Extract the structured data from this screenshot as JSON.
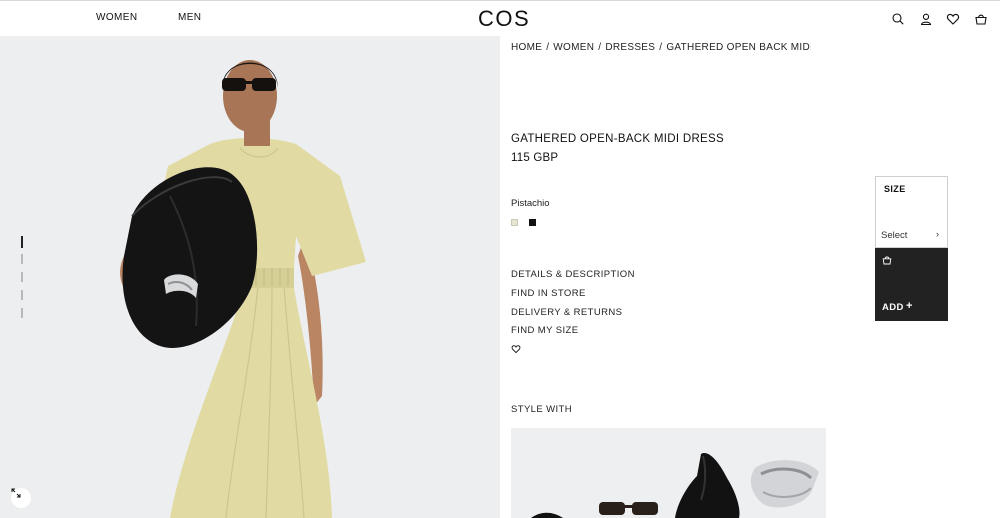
{
  "header": {
    "nav": [
      "WOMEN",
      "MEN"
    ],
    "logo": "COS",
    "icons": [
      "search-icon",
      "account-icon",
      "wishlist-heart-icon",
      "basket-icon"
    ]
  },
  "breadcrumb": [
    "HOME",
    "WOMEN",
    "DRESSES",
    "GATHERED OPEN BACK MIDI DRESS"
  ],
  "breadcrumb_separator": "/",
  "product": {
    "title": "GATHERED OPEN-BACK MIDI DRESS",
    "price": "115 GBP",
    "color_name": "Pistachio",
    "swatches": [
      {
        "name": "Pistachio",
        "color": "#e7e6d3",
        "selected": true
      },
      {
        "name": "black",
        "color": "#111111",
        "selected": false
      }
    ]
  },
  "info_links": [
    "DETAILS & DESCRIPTION",
    "FIND IN STORE",
    "DELIVERY & RETURNS",
    "FIND MY SIZE"
  ],
  "size_panel": {
    "label": "SIZE",
    "select_placeholder": "Select",
    "chevron": "›"
  },
  "add_button": {
    "label": "ADD",
    "plus": "+",
    "icon": "basket-icon"
  },
  "style_with": {
    "heading": "STYLE WITH"
  },
  "gallery": {
    "slide_count": 5,
    "active_slide": 1
  },
  "colors": {
    "text": "#111111",
    "add_button_bg": "#222222",
    "image_bg": "#eceef0",
    "dress": "#e1dba3"
  }
}
